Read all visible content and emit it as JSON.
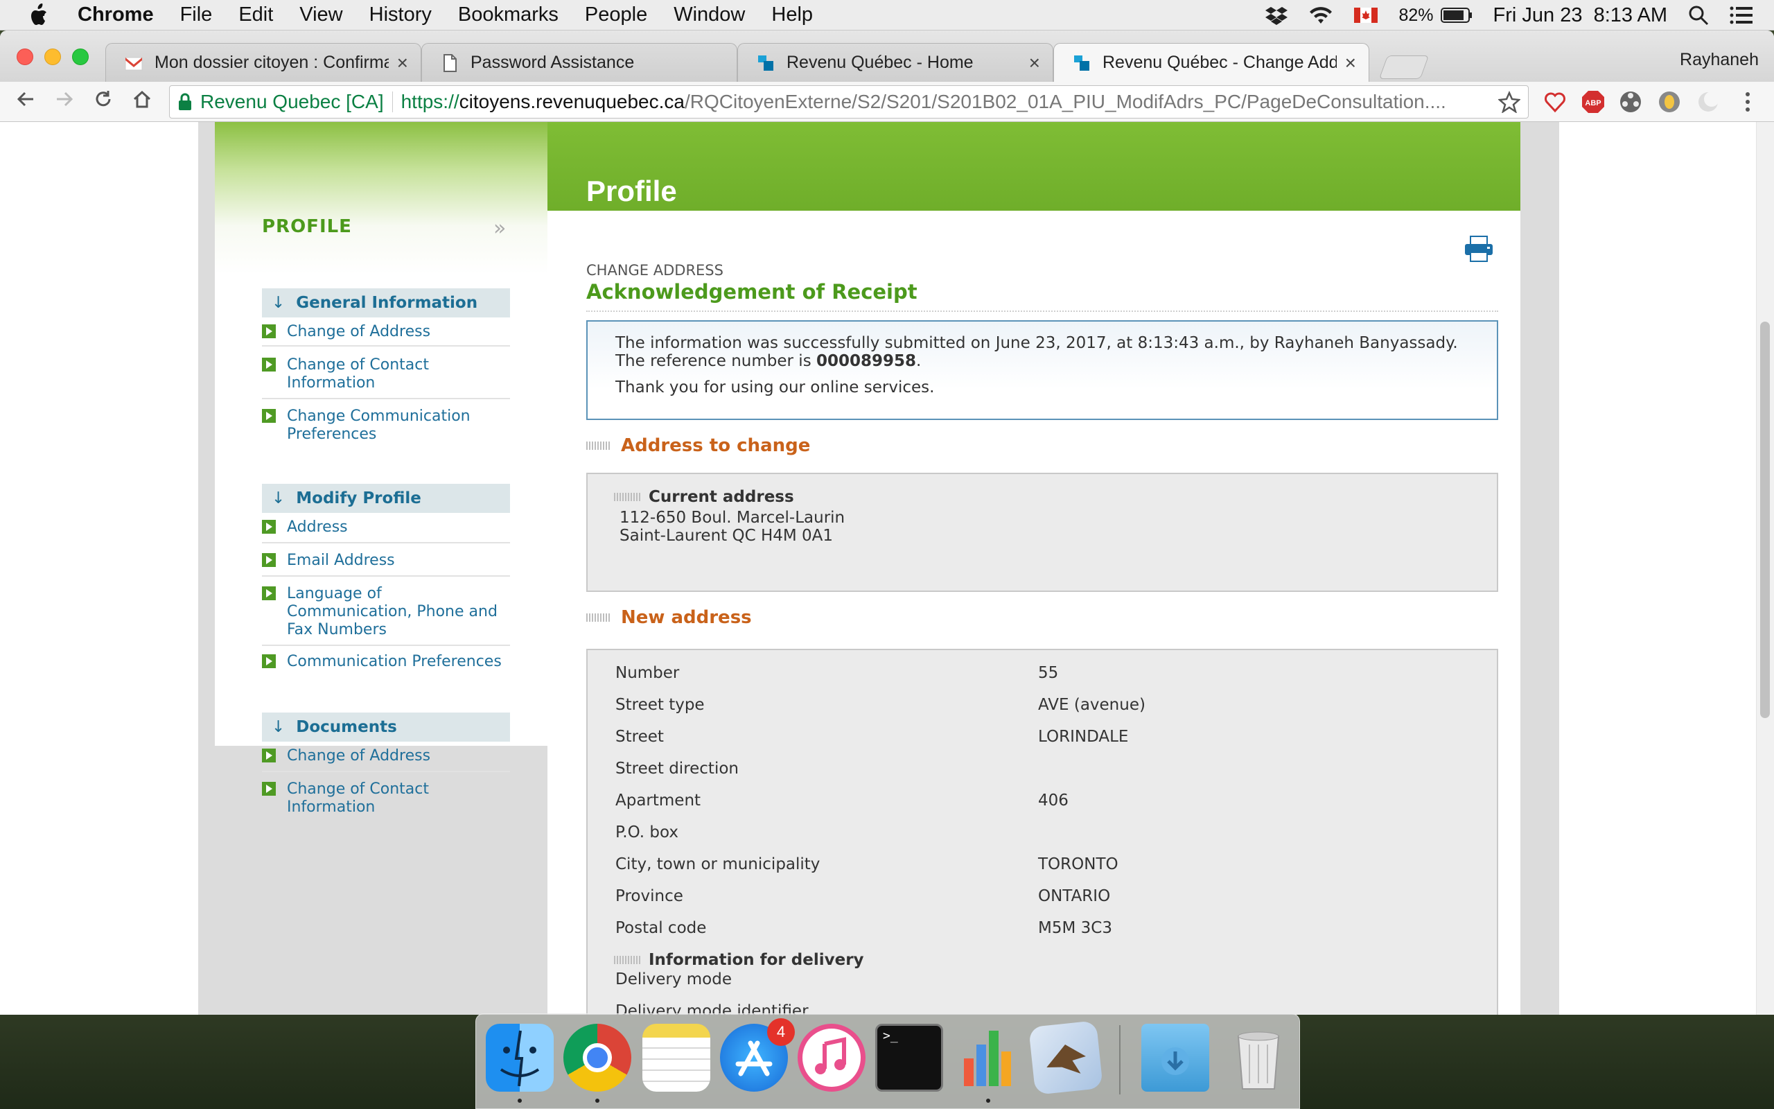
{
  "menubar": {
    "app": "Chrome",
    "items": [
      "File",
      "Edit",
      "View",
      "History",
      "Bookmarks",
      "People",
      "Window",
      "Help"
    ],
    "battery": "82%",
    "datetime": "Fri Jun 23  8:13 AM"
  },
  "tabs": [
    {
      "title": "Mon dossier citoyen : Confirma",
      "icon": "gmail-icon"
    },
    {
      "title": "Password Assistance",
      "icon": "document-icon"
    },
    {
      "title": "Revenu Québec - Home",
      "icon": "revenu-quebec-icon"
    },
    {
      "title": "Revenu Québec - Change Addr",
      "icon": "revenu-quebec-icon",
      "active": true
    }
  ],
  "profile_name": "Rayhaneh",
  "omnibox": {
    "security_label": "Revenu Quebec [CA]",
    "protocol": "https://",
    "host": "citoyens.revenuquebec.ca",
    "path": "/RQCitoyenExterne/S2/S201/S201B02_01A_PIU_ModifAdrs_PC/PageDeConsultation...."
  },
  "page_title": "Profile",
  "sidebar": {
    "heading": "PROFILE",
    "sections": [
      {
        "title": "General Information",
        "links": [
          "Change of Address",
          "Change of Contact Information",
          "Change Communication Preferences"
        ]
      },
      {
        "title": "Modify Profile",
        "links": [
          "Address",
          "Email Address",
          "Language of Communication, Phone and Fax Numbers",
          "Communication Preferences"
        ]
      },
      {
        "title": "Documents",
        "links": [
          "Change of Address",
          "Change of Contact Information"
        ]
      }
    ]
  },
  "main": {
    "eyebrow": "CHANGE ADDRESS",
    "title": "Acknowledgement of Receipt",
    "message": {
      "line1": "The information was successfully submitted on June 23, 2017, at 8:13:43 a.m., by Rayhaneh Banyassady.",
      "line2_prefix": "The reference number is ",
      "reference": "000089958",
      "line2_suffix": ".",
      "line3": "Thank you for using our online services."
    },
    "address_to_change": {
      "title": "Address to change",
      "current_label": "Current address",
      "line1": "112-650 Boul. Marcel-Laurin",
      "line2": "Saint-Laurent QC H4M 0A1"
    },
    "new_address": {
      "title": "New address",
      "rows": [
        {
          "label": "Number",
          "value": "55"
        },
        {
          "label": "Street type",
          "value": "AVE (avenue)"
        },
        {
          "label": "Street",
          "value": "LORINDALE"
        },
        {
          "label": "Street direction",
          "value": ""
        },
        {
          "label": "Apartment",
          "value": "406"
        },
        {
          "label": "P.O. box",
          "value": ""
        },
        {
          "label": "City, town or municipality",
          "value": "TORONTO"
        },
        {
          "label": "Province",
          "value": "ONTARIO"
        },
        {
          "label": "Postal code",
          "value": "M5M 3C3"
        }
      ],
      "delivery_title": "Information for delivery",
      "delivery_rows": [
        {
          "label": "Delivery mode",
          "value": ""
        },
        {
          "label": "Delivery mode identifier",
          "value": ""
        }
      ]
    }
  },
  "dock": {
    "apps": [
      "finder-icon",
      "chrome-icon",
      "notes-icon",
      "app-store-icon",
      "itunes-icon",
      "terminal-icon",
      "numbers-icon",
      "mail-icon",
      "downloads-folder-icon",
      "trash-icon"
    ],
    "app_store_badge": "4"
  },
  "colors": {
    "green": "#4c9a1c",
    "orange": "#c9621a",
    "link": "#1f6f9a",
    "banner": "#7fbd35"
  }
}
